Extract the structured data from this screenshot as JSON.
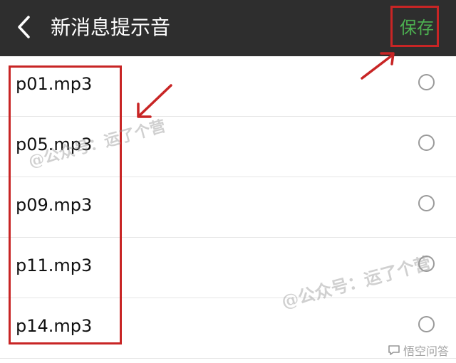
{
  "header": {
    "title": "新消息提示音",
    "save_label": "保存"
  },
  "sounds": [
    {
      "label": "p01.mp3",
      "selected": false
    },
    {
      "label": "p05.mp3",
      "selected": false
    },
    {
      "label": "p09.mp3",
      "selected": false
    },
    {
      "label": "p11.mp3",
      "selected": false
    },
    {
      "label": "p14.mp3",
      "selected": false
    }
  ],
  "watermark": {
    "text": "@公众号：运了个营"
  },
  "corner_badge": {
    "text": "悟空问答"
  },
  "colors": {
    "topbar": "#2e2e2e",
    "save_text": "#4caf50",
    "highlight": "#c82525"
  },
  "icons": {
    "back": "chevron-left-icon",
    "radio": "radio-circle-icon",
    "badge": "chat-bubble-icon"
  }
}
